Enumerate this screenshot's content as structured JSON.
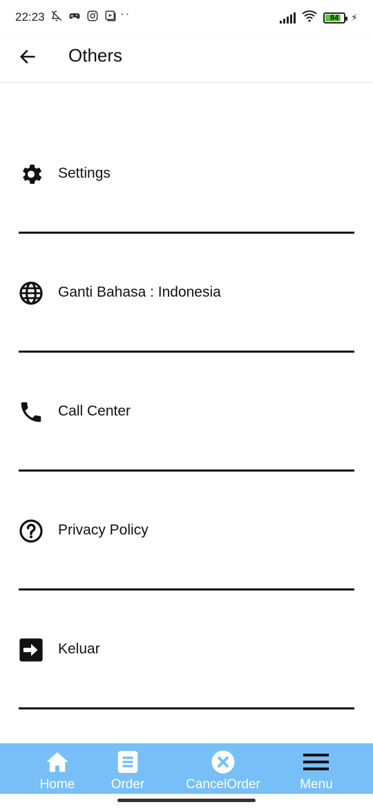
{
  "status_bar": {
    "time": "22:23",
    "battery_level": "84",
    "battery_fraction": 0.84,
    "icons": [
      "notifications-off-icon",
      "game-icon",
      "instagram-icon",
      "video-icon",
      "more-dots-icon",
      "signal-icon",
      "wifi-icon",
      "battery-icon",
      "charging-icon"
    ]
  },
  "app_bar": {
    "title": "Others",
    "back_icon": "arrow-left-icon"
  },
  "menu": {
    "items": [
      {
        "label": "Settings",
        "icon": "gear-icon"
      },
      {
        "label": "Ganti Bahasa : Indonesia",
        "icon": "globe-icon"
      },
      {
        "label": "Call Center",
        "icon": "phone-icon"
      },
      {
        "label": "Privacy Policy",
        "icon": "help-circle-icon"
      },
      {
        "label": "Keluar",
        "icon": "exit-arrow-icon"
      }
    ]
  },
  "bottom_nav": {
    "items": [
      {
        "label": "Home",
        "icon": "home-icon"
      },
      {
        "label": "Order",
        "icon": "document-icon"
      },
      {
        "label": "CancelOrder",
        "icon": "cancel-circle-icon"
      },
      {
        "label": "Menu",
        "icon": "hamburger-icon"
      }
    ]
  },
  "colors": {
    "nav_background": "#77bff6",
    "nav_text": "#ffffff",
    "battery_fill": "#57c73a",
    "divider": "#111111"
  }
}
